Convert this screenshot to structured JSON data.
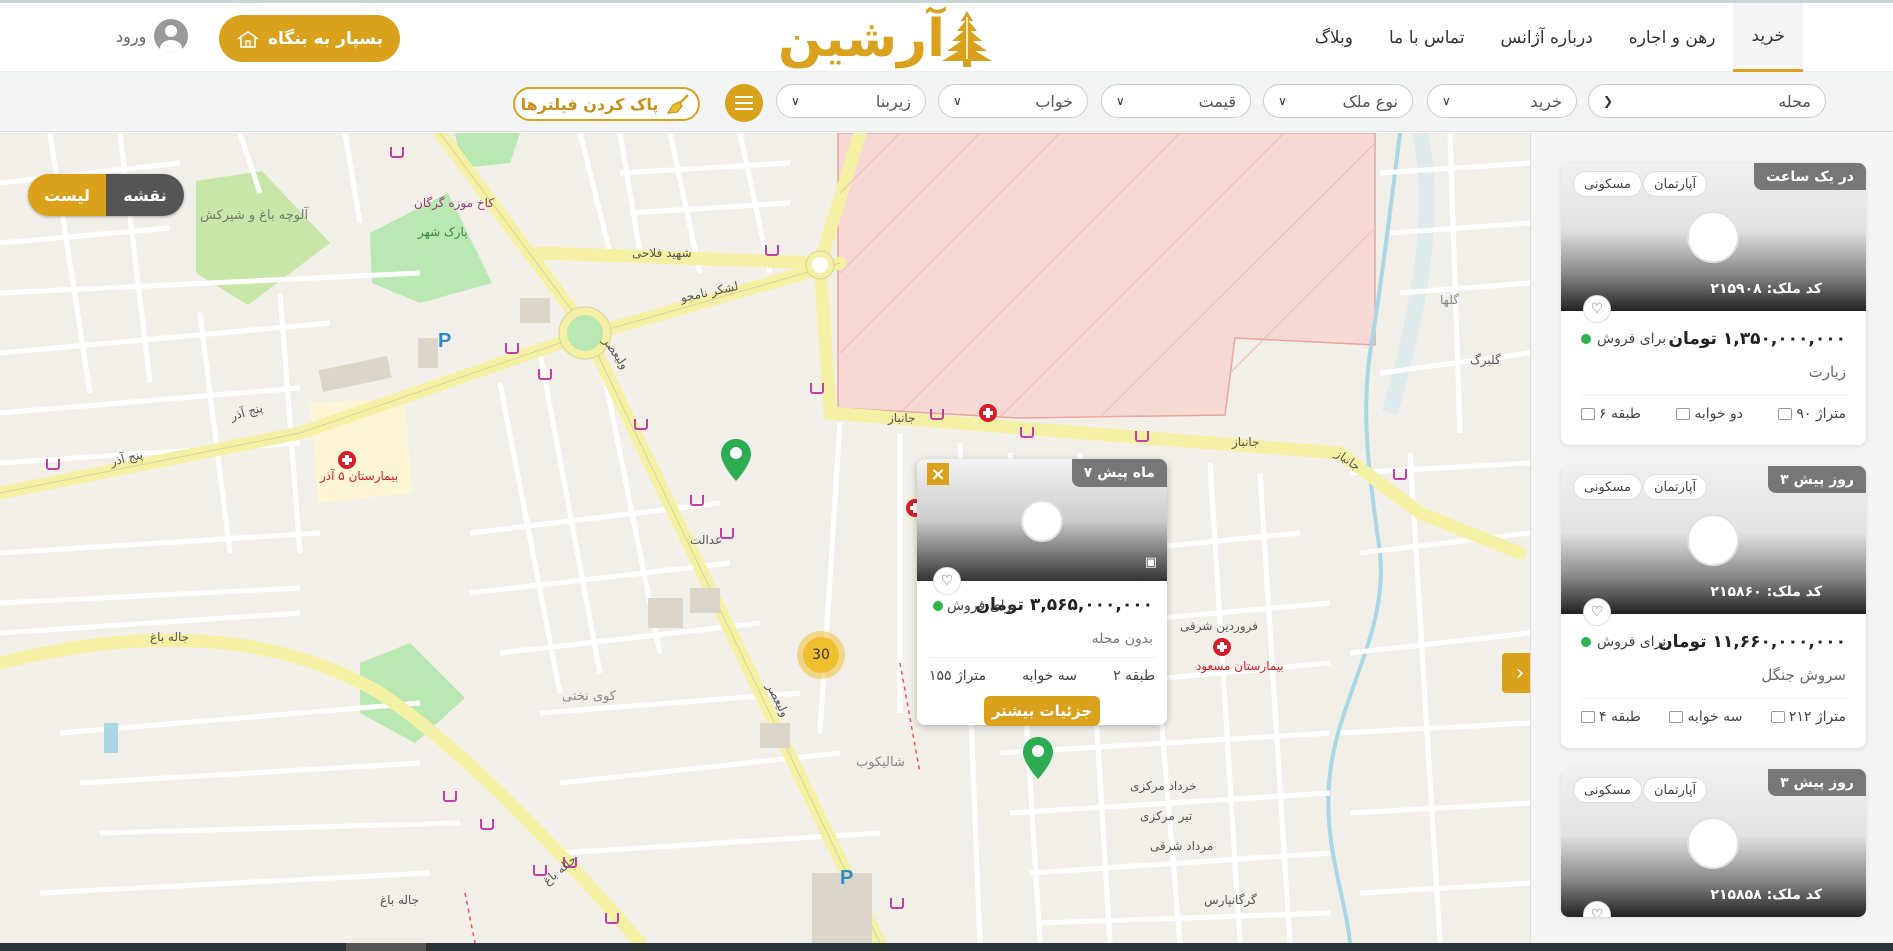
{
  "nav": {
    "items": [
      {
        "label": "خرید",
        "active": true
      },
      {
        "label": "رهن و اجاره",
        "active": false
      },
      {
        "label": "درباره آژانس",
        "active": false
      },
      {
        "label": "تماس با ما",
        "active": false
      },
      {
        "label": "وبلاگ",
        "active": false
      }
    ]
  },
  "brand": {
    "logo_text": "آرشین",
    "accent": "#d9a11c"
  },
  "header": {
    "cta_label": "بسپار به بنگاه",
    "login_label": "ورود"
  },
  "filters": {
    "neighborhood": "محله",
    "deal_type": "خرید",
    "property_type": "نوع ملک",
    "price": "قیمت",
    "bedrooms": "خواب",
    "area": "زیربنا",
    "clear_label": "پاک کردن فیلترها"
  },
  "view_toggle": {
    "map": "نقشه",
    "list": "لیست"
  },
  "map": {
    "cluster_count": "30",
    "labels": {
      "hospital_5azar": "بیمارستان ۵ آذر",
      "hospital_masoud": "بیمارستان مسعود",
      "park": "پارک شهر",
      "museum": "کاخ موزه گرگان",
      "aluche": "آلوچه باغ و شیرکش",
      "st_panjazar": "پنج آذر",
      "st_panjazar2": "پنج آذر",
      "st_valiasr": "ولیعصر",
      "st_valiasr2": "ولیعصر",
      "st_janbaz": "جانباز",
      "st_janbaz2": "جانباز",
      "st_janbaz3": "جانباز",
      "st_falahi": "شهید فلاحی",
      "st_lashkar": "لشکر نامجو",
      "st_jalehbagh": "جاله باغ",
      "st_jalehbagh2": "جاله باغ",
      "st_adalat": "عدالت",
      "st_gorgan": "گرگانپارس",
      "st_shalikoob": "شالیکوب",
      "st_kooyenakhti": "کوی نختی",
      "st_jalehbagh3": "جاله باغ",
      "st_khordad": "خرداد مرکزی",
      "st_tir": "تیر مرکزی",
      "st_mordad": "مرداد شرقی",
      "st_farvardin": "فروردین شرقی",
      "st_golha": "گلها",
      "st_golbarg": "گلبرگ"
    }
  },
  "popup": {
    "time": "۷ ماه پیش",
    "price": "۳,۵۶۵,۰۰۰,۰۰۰ تومان",
    "status": "برای فروش",
    "area": "بدون محله",
    "floor": "طبقه ۲",
    "bedrooms": "سه خوابه",
    "size": "متراژ ۱۵۵",
    "more_label": "جزئیات بیشتر"
  },
  "listings": [
    {
      "time": "در یک ساعت",
      "tag_type": "آپارتمان",
      "tag_use": "مسکونی",
      "code": "کد ملک: ۲۱۵۹۰۸",
      "price": "۱,۳۵۰,۰۰۰,۰۰۰ تومان",
      "status": "برای فروش",
      "area": "زیارت",
      "size": "متراژ ۹۰",
      "bedrooms": "دو خوابه",
      "floor": "طبقه ۶"
    },
    {
      "time": "۳ روز پیش",
      "tag_type": "آپارتمان",
      "tag_use": "مسکونی",
      "code": "کد ملک: ۲۱۵۸۶۰",
      "price": "۱۱,۶۶۰,۰۰۰,۰۰۰ تومان",
      "status": "برای فروش",
      "area": "سروش جنگل",
      "size": "متراژ ۲۱۲",
      "bedrooms": "سه خوابه",
      "floor": "طبقه ۴"
    },
    {
      "time": "۳ روز پیش",
      "tag_type": "آپارتمان",
      "tag_use": "مسکونی",
      "code": "کد ملک: ۲۱۵۸۵۸"
    }
  ],
  "icons": {
    "home": "home-icon",
    "broom": "broom-icon",
    "filter": "filter-sliders-icon",
    "heart": "heart-icon",
    "camera": "camera-icon",
    "pin": "map-pin-icon"
  }
}
